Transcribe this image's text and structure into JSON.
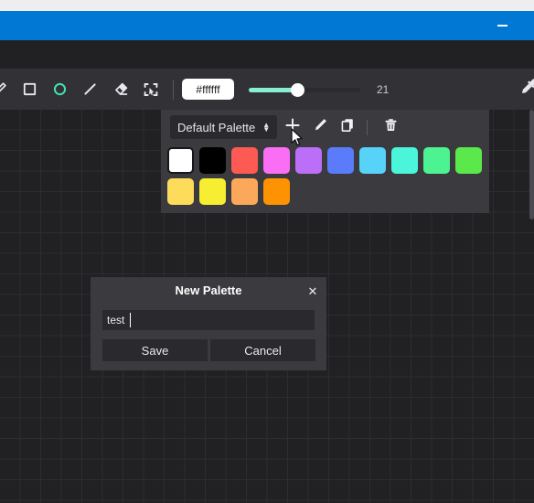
{
  "window": {
    "titlebar_color": "#0078d4",
    "minimize_label": "minimize"
  },
  "toolbar": {
    "tools": [
      {
        "name": "brush-tool",
        "icon": "brush-icon",
        "selected": false
      },
      {
        "name": "rectangle-tool",
        "icon": "square-icon",
        "selected": false
      },
      {
        "name": "ellipse-tool",
        "icon": "circle-icon",
        "selected": true
      },
      {
        "name": "line-tool",
        "icon": "line-icon",
        "selected": false
      },
      {
        "name": "eraser-tool",
        "icon": "eraser-icon",
        "selected": false
      },
      {
        "name": "select-tool",
        "icon": "selection-icon",
        "selected": false
      }
    ],
    "hex_value": "#ffffff",
    "hex_placeholder": "#ffffff",
    "brush_size_value": "21",
    "brush_size_min": 1,
    "brush_size_max": 50,
    "slider_fill_color": "#88efd4",
    "accent_color": "#42e2b0",
    "right_icon": "eyedropper-icon"
  },
  "palette_panel": {
    "selected_palette": "Default Palette",
    "palette_options": [
      "Default Palette"
    ],
    "actions": [
      {
        "name": "add-palette-button",
        "icon": "plus-icon"
      },
      {
        "name": "edit-palette-button",
        "icon": "pencil-icon"
      },
      {
        "name": "duplicate-palette-button",
        "icon": "duplicate-icon"
      },
      {
        "name": "delete-palette-button",
        "icon": "trash-icon"
      }
    ],
    "swatches": [
      {
        "color": "#ffffff",
        "selected": true
      },
      {
        "color": "#000000",
        "selected": false
      },
      {
        "color": "#fc5a53",
        "selected": false
      },
      {
        "color": "#fa6ef5",
        "selected": false
      },
      {
        "color": "#bb6ef7",
        "selected": false
      },
      {
        "color": "#5b7cfa",
        "selected": false
      },
      {
        "color": "#57d2f9",
        "selected": false
      },
      {
        "color": "#4bf5d9",
        "selected": false
      },
      {
        "color": "#4df391",
        "selected": false
      },
      {
        "color": "#5ae84a",
        "selected": false
      },
      {
        "color": "#fcdc5a",
        "selected": false
      },
      {
        "color": "#f7ee31",
        "selected": false
      },
      {
        "color": "#fca85a",
        "selected": false
      },
      {
        "color": "#fd9202",
        "selected": false
      }
    ]
  },
  "dialog": {
    "title": "New Palette",
    "close_label": "✕",
    "input_value": "test",
    "input_placeholder": "",
    "save_label": "Save",
    "cancel_label": "Cancel"
  }
}
